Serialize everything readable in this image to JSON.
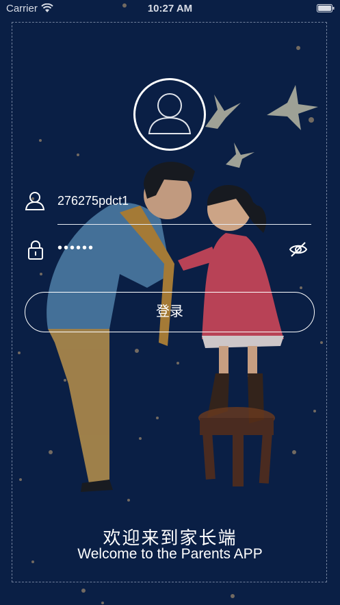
{
  "status_bar": {
    "carrier": "Carrier",
    "time": "10:27 AM"
  },
  "login": {
    "username_value": "276275pdct1",
    "password_value": "••••••",
    "login_button_label": "登录"
  },
  "welcome": {
    "title_cn": "欢迎来到家长端",
    "subtitle_en": "Welcome to the Parents APP"
  },
  "colors": {
    "background": "#0a1f45",
    "accent": "#ffffff"
  },
  "icons": [
    "wifi-icon",
    "battery-icon",
    "avatar-placeholder-icon",
    "user-icon",
    "lock-icon",
    "eye-off-icon"
  ]
}
